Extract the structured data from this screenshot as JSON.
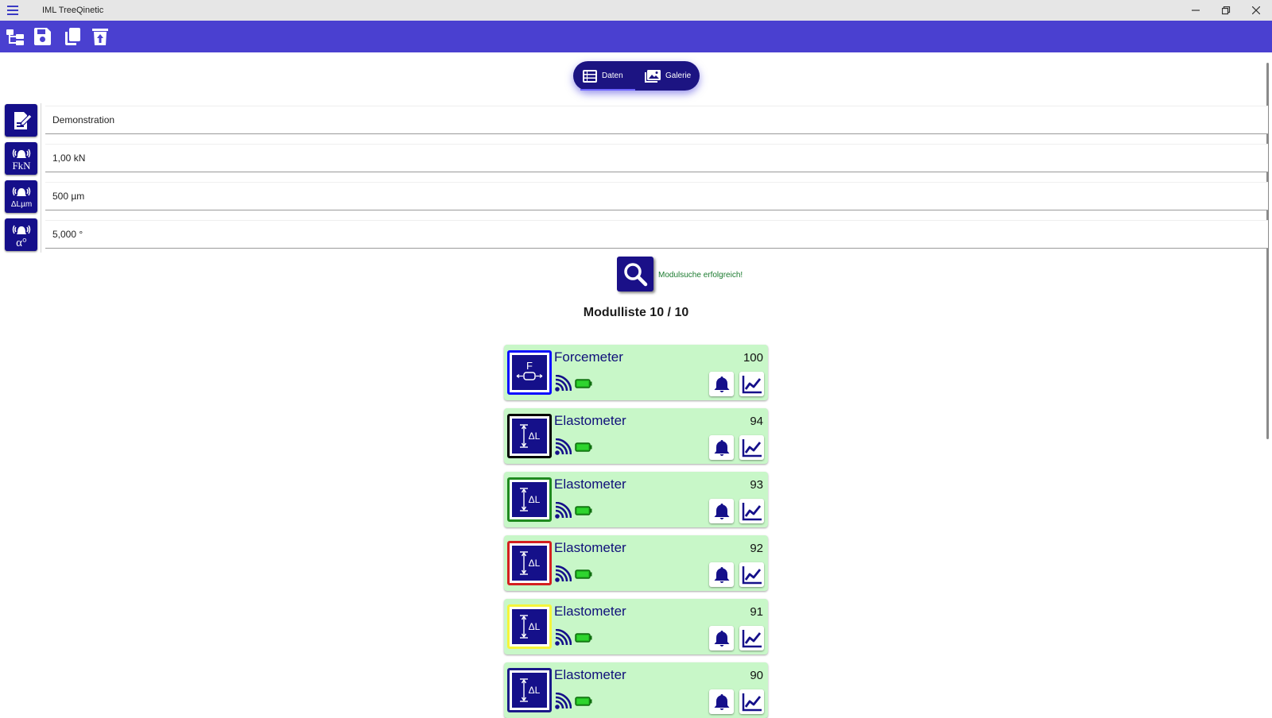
{
  "window": {
    "title": "IML TreeQinetic"
  },
  "toolbar": {
    "buttons": [
      "tree-icon",
      "save-icon",
      "copy-icon",
      "delete-upload-icon"
    ]
  },
  "view_switch": {
    "tabs": [
      {
        "label": "Daten",
        "icon": "table-icon",
        "selected": true
      },
      {
        "label": "Galerie",
        "icon": "image-icon",
        "selected": false
      }
    ]
  },
  "fields": {
    "name": {
      "value": "Demonstration",
      "icon": "edit-document-icon"
    },
    "force": {
      "value": "1,00 kN",
      "icon": "force-alarm-icon",
      "icon_text": "FkN"
    },
    "elongation": {
      "value": "500 µm",
      "icon": "elongation-alarm-icon",
      "icon_text": "ΔLµm"
    },
    "angle": {
      "value": "5,000 °",
      "icon": "angle-alarm-icon",
      "icon_text": "α°"
    }
  },
  "search": {
    "status": "Modulsuche erfolgreich!"
  },
  "module_list": {
    "title": "Modulliste  10 / 10",
    "items": [
      {
        "name": "Forcemeter",
        "number": "100",
        "type": "force",
        "frame_color": "#0a0aff"
      },
      {
        "name": "Elastometer",
        "number": "94",
        "type": "elastometer",
        "frame_color": "#000000"
      },
      {
        "name": "Elastometer",
        "number": "93",
        "type": "elastometer",
        "frame_color": "#1f8a1f"
      },
      {
        "name": "Elastometer",
        "number": "92",
        "type": "elastometer",
        "frame_color": "#d42020"
      },
      {
        "name": "Elastometer",
        "number": "91",
        "type": "elastometer",
        "frame_color": "#f5f53a"
      },
      {
        "name": "Elastometer",
        "number": "90",
        "type": "elastometer",
        "frame_color": "#1a1a8a"
      }
    ]
  },
  "colors": {
    "accent": "#4a40d0",
    "dark_blue": "#150f8a",
    "card_bg": "#c8f7c8",
    "status_green": "#1a7a2e",
    "battery_green": "#22b822"
  }
}
